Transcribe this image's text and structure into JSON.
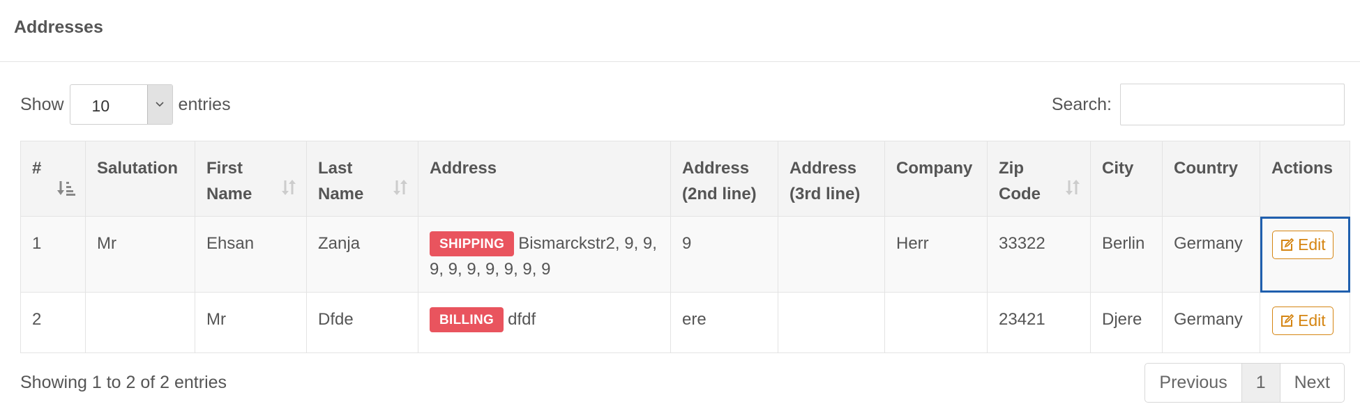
{
  "panel": {
    "title": "Addresses"
  },
  "length": {
    "show_label": "Show",
    "value": "10",
    "entries_label": "entries"
  },
  "search": {
    "label": "Search:",
    "value": ""
  },
  "table": {
    "headers": [
      "#",
      "Salutation",
      "First Name",
      "Last Name",
      "Address",
      "Address (2nd line)",
      "Address (3rd line)",
      "Company",
      "Zip Code",
      "City",
      "Country",
      "Actions"
    ],
    "header_lines": {
      "first_name": [
        "First",
        "Name"
      ],
      "last_name": [
        "Last",
        "Name"
      ],
      "address2": [
        "Address",
        "(2nd line)"
      ],
      "address3": [
        "Address",
        "(3rd line)"
      ],
      "zip": [
        "Zip",
        "Code"
      ]
    },
    "rows": [
      {
        "num": "1",
        "salutation": "Mr",
        "first_name": "Ehsan",
        "last_name": "Zanja",
        "address_type": "SHIPPING",
        "address": "Bismarckstr2, 9, 9, 9, 9, 9, 9, 9, 9, 9",
        "address2": "9",
        "address3": "",
        "company": "Herr",
        "zip": "33322",
        "city": "Berlin",
        "country": "Germany",
        "action": "Edit"
      },
      {
        "num": "2",
        "salutation": "",
        "first_name": "Mr",
        "last_name": "Dfde",
        "address_type": "BILLING",
        "address": "dfdf",
        "address2": "ere",
        "address3": "",
        "company": "",
        "zip": "23421",
        "city": "Djere",
        "country": "Germany",
        "action": "Edit"
      }
    ]
  },
  "footer": {
    "info": "Showing 1 to 2 of 2 entries",
    "previous": "Previous",
    "page": "1",
    "next": "Next"
  },
  "icons": {
    "sort_active": "sort-amount-asc-icon",
    "sort_both": "sort-both-icon",
    "edit": "edit-icon",
    "select_arrow": "chevron-down-icon"
  },
  "colors": {
    "label_bg": "#e9545e",
    "edit_accent": "#d58512",
    "focus_outline": "#1f5fae"
  }
}
